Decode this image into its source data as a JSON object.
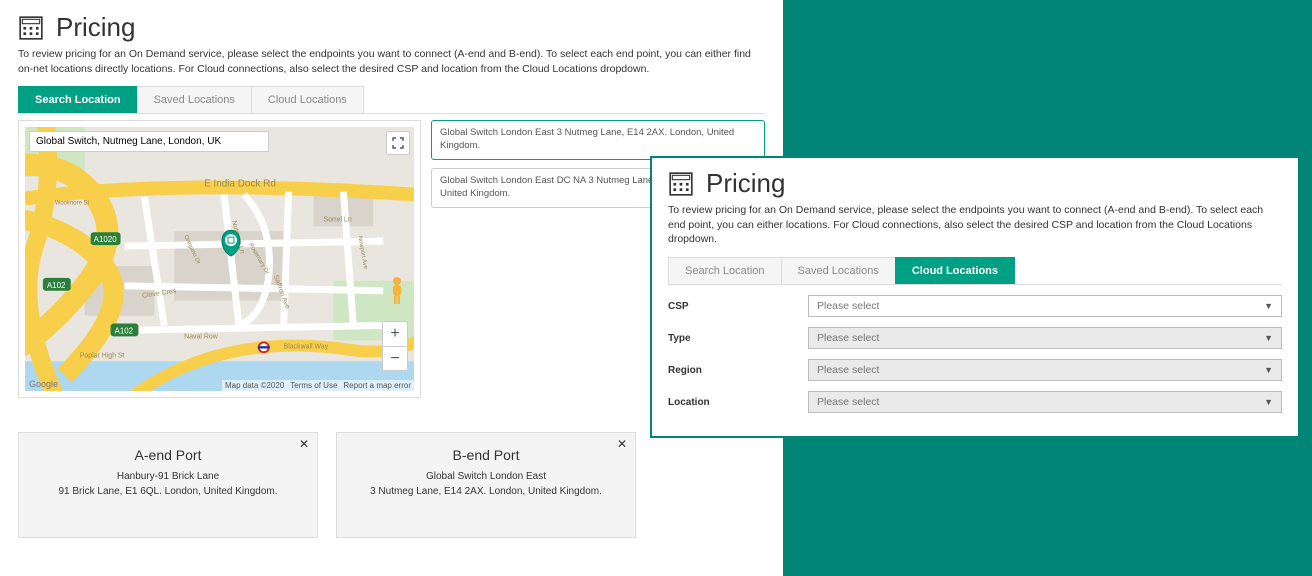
{
  "left": {
    "title": "Pricing",
    "intro": "To review pricing for an On Demand service, please select the endpoints you want to connect (A-end and B-end). To select each end point, you can either find on-net locations directly locations. For Cloud connections, also select the desired CSP and location from the Cloud Locations dropdown.",
    "tabs": [
      "Search Location",
      "Saved Locations",
      "Cloud Locations"
    ],
    "activeTab": 0,
    "map": {
      "address": "Global Switch, Nutmeg Lane, London, UK",
      "credits": {
        "data": "Map data ©2020",
        "terms": "Terms of Use",
        "report": "Report a map error",
        "google": "Google"
      },
      "roads": {
        "main": "E India Dock Rd",
        "a1020": "A1020",
        "a102a": "A102",
        "a102b": "A102",
        "blackwall": "Blackwall Way",
        "naval": "Naval Row",
        "poplar": "Poplar High St",
        "clove": "Clove Cres",
        "nutmeg": "Nutmeg Ln",
        "saffron": "Saffron Ave",
        "sorrel": "Sorrel Ln",
        "rosemary": "Rosemary Dr",
        "oregano": "Oregano Dr",
        "newport": "Newport Ave",
        "woolmore": "Woolmore St"
      }
    },
    "results": [
      "Global Switch London East 3 Nutmeg Lane, E14 2AX. London, United Kingdom.",
      "Global Switch London East DC NA 3 Nutmeg Lane, E14 2AX. London, United Kingdom."
    ],
    "ports": [
      {
        "title": "A-end Port",
        "name": "Hanbury-91 Brick Lane",
        "addr": "91 Brick Lane, E1 6QL. London, United Kingdom."
      },
      {
        "title": "B-end Port",
        "name": "Global Switch London East",
        "addr": "3 Nutmeg Lane, E14 2AX. London, United Kingdom."
      }
    ]
  },
  "right": {
    "title": "Pricing",
    "intro": "To review pricing for an On Demand service, please select the endpoints you want to connect (A-end and B-end). To select each end point, you can either locations. For Cloud connections, also select the desired CSP and location from the Cloud Locations dropdown.",
    "tabs": [
      "Search Location",
      "Saved Locations",
      "Cloud Locations"
    ],
    "activeTab": 2,
    "fields": [
      {
        "label": "CSP",
        "value": "Please select",
        "disabled": false
      },
      {
        "label": "Type",
        "value": "Please select",
        "disabled": true
      },
      {
        "label": "Region",
        "value": "Please select",
        "disabled": true
      },
      {
        "label": "Location",
        "value": "Please select",
        "disabled": true
      }
    ]
  }
}
